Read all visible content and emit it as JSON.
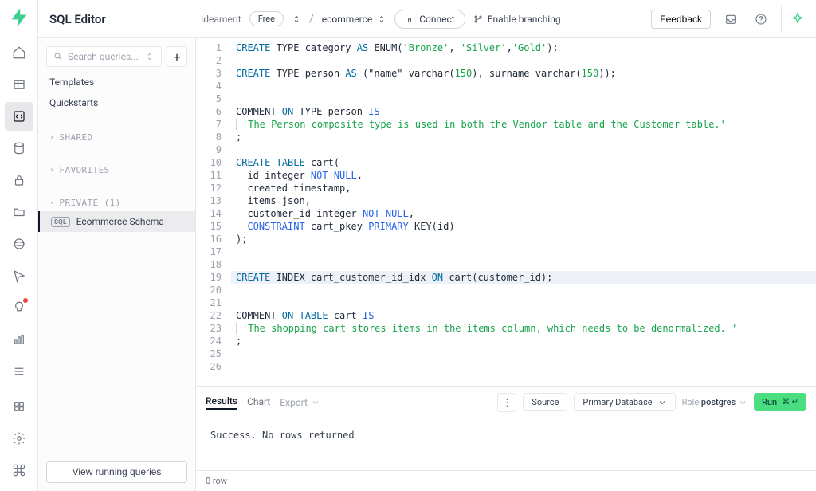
{
  "header": {
    "title": "SQL Editor",
    "org": "Ideamerit",
    "plan": "Free",
    "project": "ecommerce",
    "connect_label": "Connect",
    "branching_label": "Enable branching",
    "feedback_label": "Feedback"
  },
  "sidebar": {
    "search_placeholder": "Search queries...",
    "templates_label": "Templates",
    "quickstarts_label": "Quickstarts",
    "sections": {
      "shared": "SHARED",
      "favorites": "FAVORITES",
      "private": "PRIVATE (1)"
    },
    "private_items": [
      {
        "badge": "SQL",
        "label": "Ecommerce Schema"
      }
    ],
    "footer_button": "View running queries"
  },
  "editor": {
    "lines": [
      [
        {
          "t": "CREATE",
          "c": "kw"
        },
        {
          "t": " TYPE category "
        },
        {
          "t": "AS",
          "c": "kw"
        },
        {
          "t": " ENUM("
        },
        {
          "t": "'Bronze'",
          "c": "str"
        },
        {
          "t": ", "
        },
        {
          "t": "'Silver'",
          "c": "str"
        },
        {
          "t": ","
        },
        {
          "t": "'Gold'",
          "c": "str"
        },
        {
          "t": ");"
        }
      ],
      [],
      [
        {
          "t": "CREATE",
          "c": "kw"
        },
        {
          "t": " TYPE person "
        },
        {
          "t": "AS",
          "c": "kw"
        },
        {
          "t": " (\"name\" varchar("
        },
        {
          "t": "150",
          "c": "num"
        },
        {
          "t": "), surname varchar("
        },
        {
          "t": "150",
          "c": "num"
        },
        {
          "t": "));"
        }
      ],
      [],
      [],
      [
        {
          "t": "COMMENT "
        },
        {
          "t": "ON",
          "c": "kw"
        },
        {
          "t": " TYPE person "
        },
        {
          "t": "IS",
          "c": "kw2"
        }
      ],
      [
        {
          "bar": true
        },
        {
          "t": "'The Person composite type is used in both the Vendor table and the Customer table.'",
          "c": "str"
        }
      ],
      [
        {
          "t": ";"
        }
      ],
      [],
      [
        {
          "t": "CREATE",
          "c": "kw"
        },
        {
          "t": " "
        },
        {
          "t": "TABLE",
          "c": "kw"
        },
        {
          "t": " cart("
        }
      ],
      [
        {
          "t": "  id integer "
        },
        {
          "t": "NOT NULL",
          "c": "kw2"
        },
        {
          "t": ","
        }
      ],
      [
        {
          "t": "  created timestamp,"
        }
      ],
      [
        {
          "t": "  items json,"
        }
      ],
      [
        {
          "t": "  customer_id integer "
        },
        {
          "t": "NOT NULL",
          "c": "kw2"
        },
        {
          "t": ","
        }
      ],
      [
        {
          "t": "  "
        },
        {
          "t": "CONSTRAINT",
          "c": "kw2"
        },
        {
          "t": " cart_pkey "
        },
        {
          "t": "PRIMARY",
          "c": "kw2"
        },
        {
          "t": " KEY(id)"
        }
      ],
      [
        {
          "t": ");"
        }
      ],
      [],
      [],
      [
        {
          "t": "CREATE",
          "c": "kw"
        },
        {
          "t": " INDEX cart_customer_id_idx "
        },
        {
          "t": "ON",
          "c": "kw"
        },
        {
          "t": " cart(customer_id);"
        }
      ],
      [],
      [],
      [
        {
          "t": "COMMENT "
        },
        {
          "t": "ON",
          "c": "kw"
        },
        {
          "t": " "
        },
        {
          "t": "TABLE",
          "c": "kw"
        },
        {
          "t": " cart "
        },
        {
          "t": "IS",
          "c": "kw2"
        }
      ],
      [
        {
          "bar": true
        },
        {
          "t": "'The shopping cart stores items in the items column, which needs to be denormalized. '",
          "c": "str"
        }
      ],
      [
        {
          "t": ";"
        }
      ],
      [],
      []
    ],
    "highlight_line": 19
  },
  "results": {
    "tabs": {
      "results": "Results",
      "chart": "Chart",
      "export": "Export"
    },
    "source_label": "Source",
    "primary_db": "Primary Database",
    "role_label": "Role",
    "role_value": "postgres",
    "run_label": "Run",
    "message": "Success. No rows returned",
    "footer": "0 row"
  }
}
